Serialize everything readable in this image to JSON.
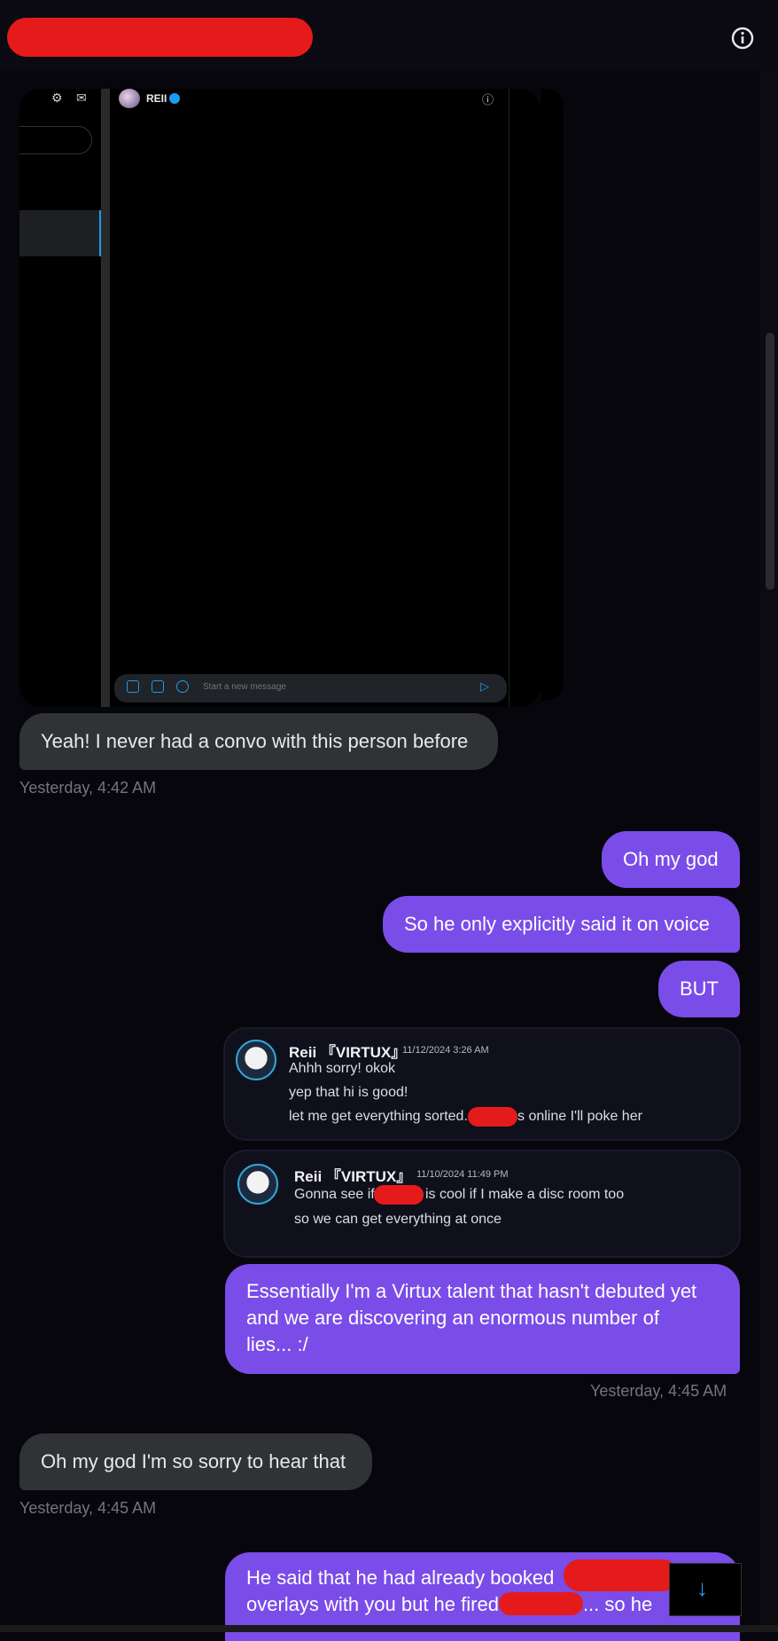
{
  "header": {
    "info_icon": "info-icon"
  },
  "embedded_screenshot": {
    "contact_name": "REII",
    "input_placeholder": "Start a new message",
    "icons": [
      "gear-icon",
      "compose-message-icon",
      "info-icon",
      "image-icon",
      "gif-icon",
      "emoji-icon",
      "send-icon"
    ]
  },
  "messages": [
    {
      "id": "m1",
      "dir": "in",
      "text": "Yeah! I never had a convo with this person before",
      "time": "Yesterday, 4:42 AM"
    },
    {
      "id": "m2",
      "dir": "out",
      "text": "Oh my god"
    },
    {
      "id": "m3",
      "dir": "out",
      "text": "So he only explicitly said it on voice"
    },
    {
      "id": "m4",
      "dir": "out",
      "text": "BUT"
    },
    {
      "id": "m5",
      "dir": "out",
      "lines": [
        "Essentially I'm a Virtux talent that hasn't debuted yet",
        "and we are discovering an enormous number of",
        "lies... :/"
      ],
      "time": "Yesterday, 4:45 AM"
    },
    {
      "id": "m6",
      "dir": "in",
      "text": "Oh my god I'm so sorry to hear that",
      "time": "Yesterday, 4:45 AM"
    },
    {
      "id": "m7",
      "dir": "out",
      "lines": [
        "He said that he had already booked",
        "overlays with you but he fired",
        "... so he"
      ]
    }
  ],
  "quotes": [
    {
      "user": "Reii 『VIRTUX』",
      "date": "11/12/2024 3:26 AM",
      "lines": [
        "Ahhh sorry! okok",
        "yep that hi is good!",
        "let me get everything sorted.",
        "s online I'll poke her"
      ]
    },
    {
      "user": "Reii 『VIRTUX』",
      "date": "11/10/2024 11:49 PM",
      "lines": [
        "Gonna see if",
        "is cool if I make a disc room too",
        "so we can get everything at once"
      ]
    }
  ],
  "scroll_button": {
    "icon": "arrow-down-icon",
    "symbol": "↓"
  }
}
